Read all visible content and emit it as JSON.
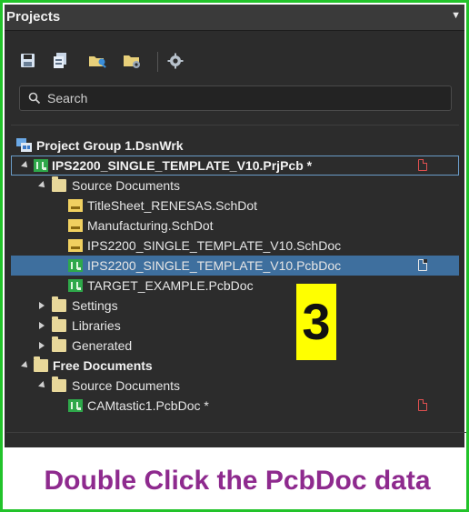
{
  "panel": {
    "title": "Projects",
    "menu_glyph": "▼"
  },
  "toolbar": {
    "buttons": [
      {
        "icon": "save-icon"
      },
      {
        "icon": "save-all-icon"
      },
      {
        "icon": "open-project-icon"
      },
      {
        "icon": "project-folder-icon"
      },
      {
        "icon": "settings-gear-icon"
      }
    ]
  },
  "search": {
    "placeholder": "Search"
  },
  "tree": {
    "project_group": "Project Group 1.DsnWrk",
    "project": "IPS2200_SINGLE_TEMPLATE_V10.PrjPcb *",
    "source_documents": "Source Documents",
    "files": [
      {
        "label": "TitleSheet_RENESAS.SchDot",
        "type": "schdot"
      },
      {
        "label": "Manufacturing.SchDot",
        "type": "schdot"
      },
      {
        "label": "IPS2200_SINGLE_TEMPLATE_V10.SchDoc",
        "type": "schdoc"
      },
      {
        "label": "IPS2200_SINGLE_TEMPLATE_V10.PcbDoc",
        "type": "pcbdoc",
        "selected": true
      },
      {
        "label": "TARGET_EXAMPLE.PcbDoc",
        "type": "pcbdoc"
      }
    ],
    "settings": "Settings",
    "libraries": "Libraries",
    "generated": "Generated",
    "free_documents": "Free Documents",
    "free_source_documents": "Source Documents",
    "free_file": "CAMtastic1.PcbDoc *"
  },
  "annotation": {
    "step_number": "3",
    "caption": "Double Click the PcbDoc data"
  },
  "colors": {
    "frame_green": "#22c32a",
    "panel_bg": "#2c2c2c",
    "selection": "#3e6f9e",
    "badge_yellow": "#ffff00",
    "caption_purple": "#8e2a8e",
    "modified_flag_red": "#e05050"
  }
}
